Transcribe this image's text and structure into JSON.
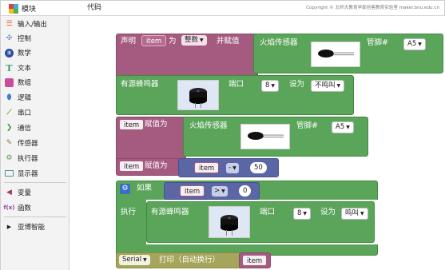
{
  "topbar": {
    "modules_tab": "模块",
    "code_tab": "代码",
    "copyright": "Copyright © 北师大教育学部创客教育实验室 maker.bnu.edu.cn"
  },
  "sidebar": {
    "items": [
      {
        "label": "输入/输出",
        "icon": "io-icon",
        "color": "#e06030"
      },
      {
        "label": "控制",
        "icon": "gamepad-icon",
        "color": "#4a7fc8"
      },
      {
        "label": "数学",
        "icon": "math-icon",
        "color": "#2a4fa0"
      },
      {
        "label": "文本",
        "icon": "text-icon",
        "color": "#3aa07a"
      },
      {
        "label": "数组",
        "icon": "array-icon",
        "color": "#c84d9c"
      },
      {
        "label": "逻辑",
        "icon": "logic-icon",
        "color": "#3a7fd0"
      },
      {
        "label": "串口",
        "icon": "serial-icon",
        "color": "#7a9a3a"
      },
      {
        "label": "通信",
        "icon": "comm-icon",
        "color": "#36a040"
      },
      {
        "label": "传感器",
        "icon": "sensor-icon",
        "color": "#8a7a5a"
      },
      {
        "label": "执行器",
        "icon": "actuator-icon",
        "color": "#5aa05a"
      },
      {
        "label": "显示器",
        "icon": "display-icon",
        "color": "#5a8aa0"
      },
      {
        "label": "变量",
        "icon": "variable-icon",
        "color": "#a03a60"
      },
      {
        "label": "函数",
        "icon": "function-icon",
        "color": "#8a4aa0"
      },
      {
        "label": "亚博智能",
        "icon": "triangle-right-icon",
        "color": "#222"
      }
    ]
  },
  "blocks": {
    "declare": {
      "text1": "声明",
      "var": "item",
      "text2": "为",
      "type": "整数",
      "text3": "并赋值"
    },
    "flame1": {
      "label": "火焰传感器",
      "pin_label": "管脚#",
      "pin": "A5"
    },
    "buzzer1": {
      "label": "有源蜂鸣器",
      "port_label": "端口",
      "port": "8",
      "set_label": "设为",
      "state": "不鸣叫"
    },
    "assign1": {
      "var": "item",
      "label": "赋值为"
    },
    "flame2": {
      "label": "火焰传感器",
      "pin_label": "管脚#",
      "pin": "A5"
    },
    "assign2": {
      "var": "item",
      "label": "赋值为",
      "expr_var": "item",
      "op": "-",
      "value": "50"
    },
    "if_block": {
      "if_label": "如果",
      "cond_var": "item",
      "op": ">",
      "value": "0",
      "do_label": "执行"
    },
    "buzzer2": {
      "label": "有源蜂鸣器",
      "port_label": "端口",
      "port": "8",
      "set_label": "设为",
      "state": "鸣叫"
    },
    "serial": {
      "serial": "Serial",
      "label": "打印（自动换行）",
      "var": "item"
    }
  },
  "colors": {
    "green": "#5ba55b",
    "green_dark": "#3f8a3f",
    "purple": "#a55b80",
    "slate": "#5b67a5",
    "olive": "#a5a55b"
  }
}
